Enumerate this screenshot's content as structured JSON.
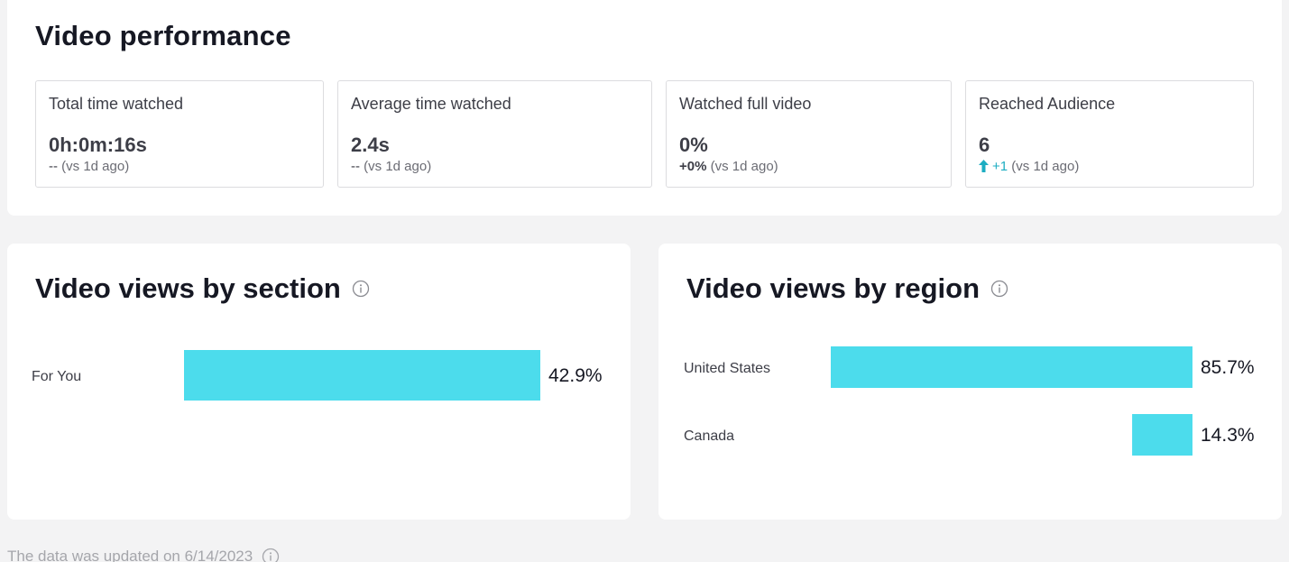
{
  "performance": {
    "title": "Video performance",
    "stats": [
      {
        "label": "Total time watched",
        "value": "0h:0m:16s",
        "delta_value": "--",
        "delta_suffix": "(vs 1d ago)",
        "trend": "none"
      },
      {
        "label": "Average time watched",
        "value": "2.4s",
        "delta_value": "--",
        "delta_suffix": "(vs 1d ago)",
        "trend": "none"
      },
      {
        "label": "Watched full video",
        "value": "0%",
        "delta_value": "+0%",
        "delta_suffix": "(vs 1d ago)",
        "trend": "none"
      },
      {
        "label": "Reached Audience",
        "value": "6",
        "delta_value": "+1",
        "delta_suffix": "(vs 1d ago)",
        "trend": "up"
      }
    ]
  },
  "section_chart": {
    "title": "Video views by section",
    "icon": "info-icon"
  },
  "region_chart": {
    "title": "Video views by region",
    "icon": "info-icon"
  },
  "chart_data": [
    {
      "type": "bar",
      "orientation": "horizontal",
      "title": "Video views by section",
      "categories": [
        "For You"
      ],
      "values": [
        42.9
      ],
      "value_labels": [
        "42.9%"
      ],
      "xlim": [
        0,
        100
      ],
      "grid": false,
      "color": "#4cdcec"
    },
    {
      "type": "bar",
      "orientation": "horizontal",
      "title": "Video views by region",
      "categories": [
        "United States",
        "Canada"
      ],
      "values": [
        85.7,
        14.3
      ],
      "value_labels": [
        "85.7%",
        "14.3%"
      ],
      "xlim": [
        0,
        100
      ],
      "grid": false,
      "color": "#4cdcec"
    }
  ],
  "footer": {
    "note": "The data was updated on 6/14/2023",
    "icon": "info-icon"
  },
  "colors": {
    "accent": "#4cdcec",
    "trend_up": "#1dadc2"
  }
}
